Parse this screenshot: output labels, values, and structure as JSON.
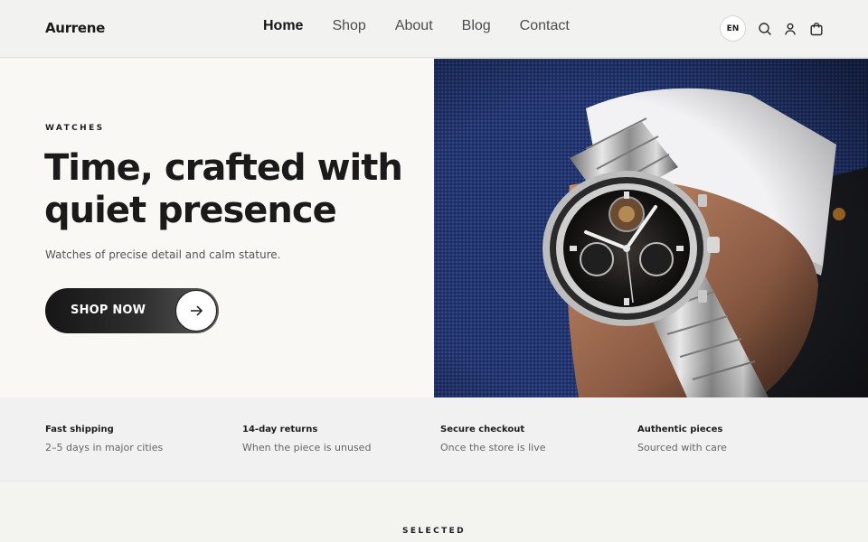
{
  "brand": {
    "name": "Aurrene"
  },
  "nav": {
    "items": [
      {
        "label": "Home",
        "active": true
      },
      {
        "label": "Shop",
        "active": false
      },
      {
        "label": "About",
        "active": false
      },
      {
        "label": "Blog",
        "active": false
      },
      {
        "label": "Contact",
        "active": false
      }
    ]
  },
  "header_actions": {
    "language": "EN",
    "icons": [
      "search-icon",
      "user-icon",
      "cart-icon"
    ]
  },
  "hero": {
    "eyebrow": "WATCHES",
    "headline_line1": "Time, crafted with",
    "headline_line2": "quiet presence",
    "subtext": "Watches of precise detail and calm stature.",
    "cta_label": "SHOP NOW",
    "cta_icon": "arrow-right-icon"
  },
  "features": [
    {
      "title": "Fast shipping",
      "desc": "2–5 days in major cities"
    },
    {
      "title": "14-day returns",
      "desc": "When the piece is unused"
    },
    {
      "title": "Secure checkout",
      "desc": "Once the store is live"
    },
    {
      "title": "Authentic pieces",
      "desc": "Sourced with care"
    }
  ],
  "section": {
    "label": "SELECTED"
  },
  "colors": {
    "background": "#f3f3ef",
    "hero_left_bg": "#f9f8f5",
    "text_primary": "#1a1a1a",
    "cta_bg": "#161616",
    "jacket_blue": "#23356e"
  }
}
